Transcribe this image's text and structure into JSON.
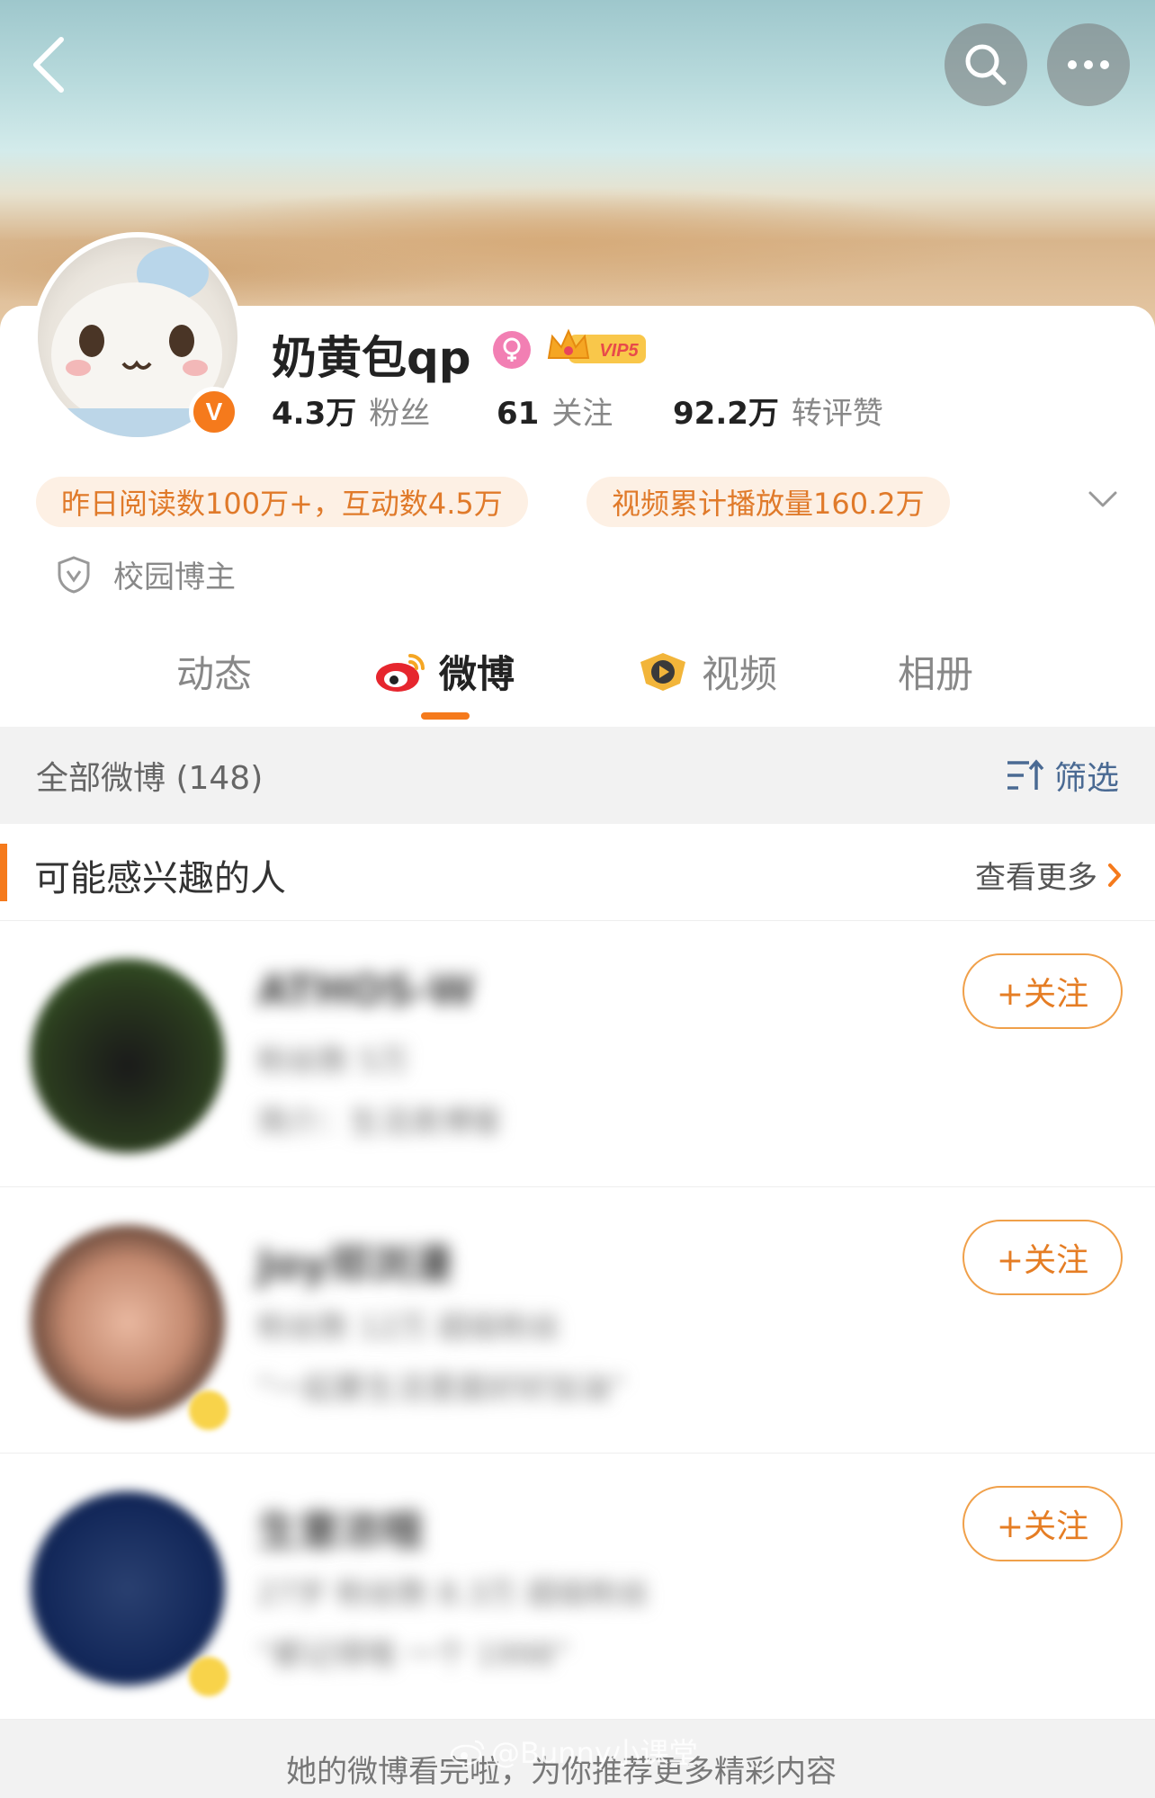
{
  "profile": {
    "name": "奶黄包qp",
    "vip_label": "VIP5",
    "verified_badge": "V",
    "stats": [
      {
        "value": "4.3万",
        "label": "粉丝"
      },
      {
        "value": "61",
        "label": "关注"
      },
      {
        "value": "92.2万",
        "label": "转评赞"
      }
    ],
    "pills": [
      "昨日阅读数100万+，互动数4.5万",
      "视频累计播放量160.2万"
    ],
    "campus_label": "校园博主"
  },
  "tabs": [
    {
      "label": "动态"
    },
    {
      "label": "微博"
    },
    {
      "label": "视频"
    },
    {
      "label": "相册"
    }
  ],
  "feed": {
    "count_label": "全部微博 (148)",
    "filter_label": "筛选"
  },
  "recommend": {
    "title": "可能感兴趣的人",
    "more_label": "查看更多",
    "follow_label": "+关注",
    "items": [
      {
        "name": "ATHOS-W",
        "meta": "粉丝数 5万",
        "desc": "简介：生活类博客"
      },
      {
        "name": "Joy郑浏漫",
        "meta": "粉丝数 12万  超级粉丝",
        "desc": "“一起要生活里面好好加油”"
      },
      {
        "name": "生意浓哦",
        "meta": "27岁  粉丝数 8.3万  超级粉丝",
        "desc": "“都记得哦 一个 1998”"
      }
    ]
  },
  "bottom": {
    "text": "她的微博看完啦，为你推荐更多精彩内容",
    "watermark": "@Bunny小课堂"
  },
  "colors": {
    "accent": "#f57a1c",
    "pill_bg": "#fdf0e4",
    "pill_text": "#e07a2a",
    "filter_text": "#4a6a93"
  }
}
